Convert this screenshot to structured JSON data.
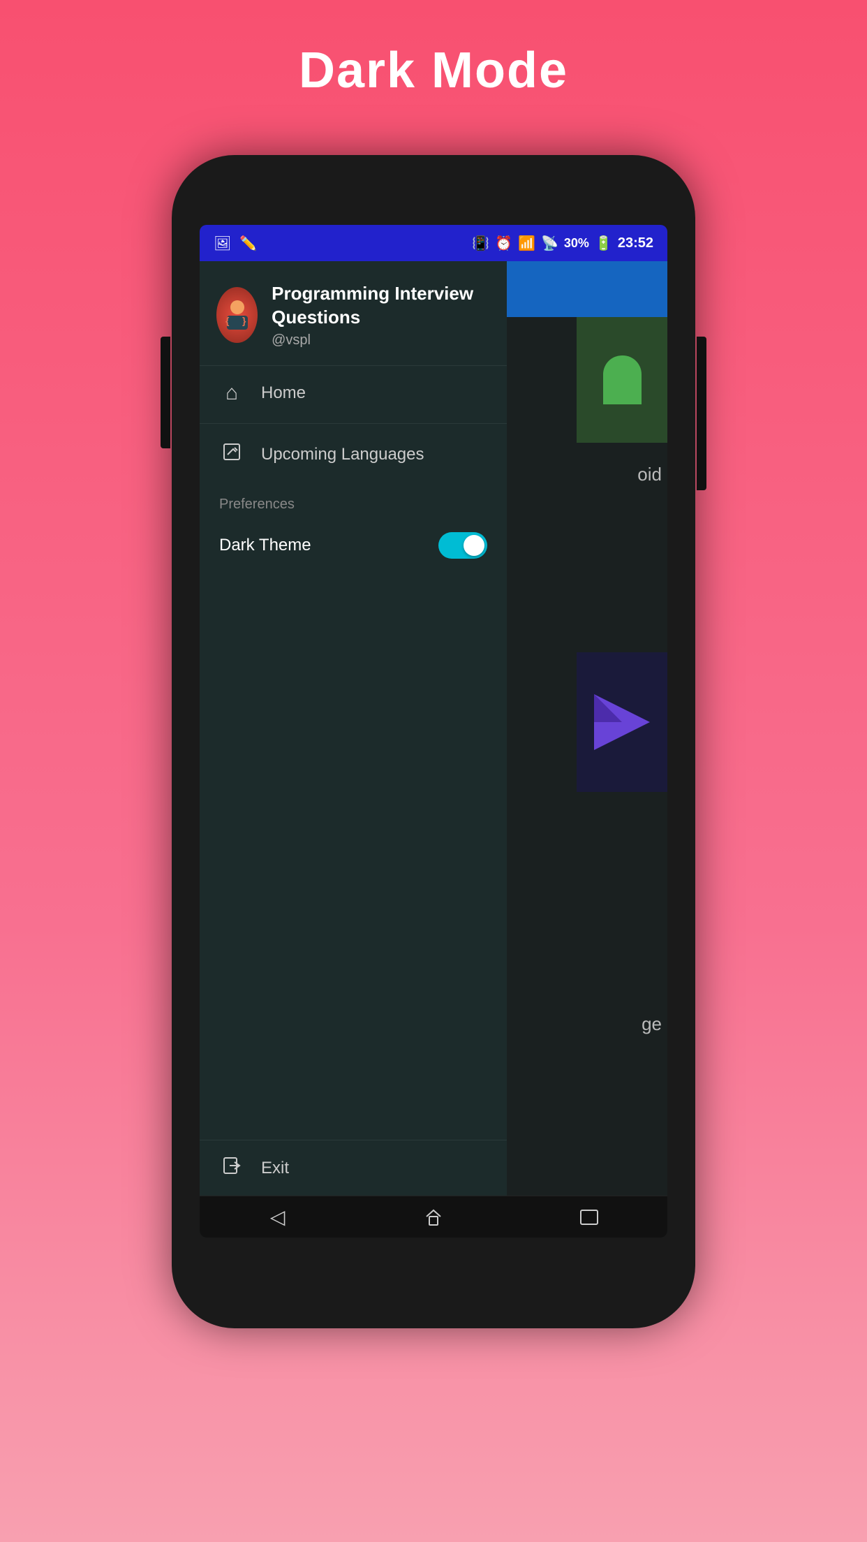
{
  "page": {
    "title": "Dark Mode",
    "background_gradient_start": "#f85070",
    "background_gradient_end": "#f8a0b0"
  },
  "status_bar": {
    "battery_percent": "30%",
    "time": "23:52",
    "icons": {
      "vibrate": "📳",
      "alarm": "⏰",
      "wifi": "WiFi",
      "signal": "Signal",
      "battery_icon": "🔋"
    }
  },
  "drawer": {
    "app_name": "Programming Interview Questions",
    "username": "@vspl",
    "nav_items": [
      {
        "label": "Home",
        "icon": "home"
      },
      {
        "label": "Upcoming Languages",
        "icon": "edit"
      }
    ],
    "preferences_section_label": "Preferences",
    "dark_theme_label": "Dark Theme",
    "dark_theme_enabled": true,
    "exit_label": "Exit"
  },
  "bottom_nav": {
    "back_label": "◁",
    "home_label": "⌂",
    "recent_label": "▭"
  }
}
